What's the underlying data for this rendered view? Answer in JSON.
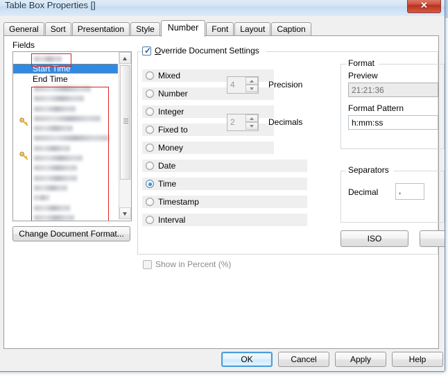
{
  "window": {
    "title": "Table Box Properties []",
    "close_icon": "close-icon",
    "close_glyph": "✕"
  },
  "tabs": [
    {
      "label": "General",
      "active": false
    },
    {
      "label": "Sort",
      "active": false
    },
    {
      "label": "Presentation",
      "active": false
    },
    {
      "label": "Style",
      "active": false
    },
    {
      "label": "Number",
      "active": true
    },
    {
      "label": "Font",
      "active": false
    },
    {
      "label": "Layout",
      "active": false
    },
    {
      "label": "Caption",
      "active": false
    }
  ],
  "fields": {
    "label": "Fields",
    "items": [
      {
        "text": "",
        "redacted": true,
        "selected": false,
        "key": false
      },
      {
        "text": "Start Time",
        "redacted": false,
        "selected": true,
        "key": false
      },
      {
        "text": "End Time",
        "redacted": false,
        "selected": false,
        "key": false
      },
      {
        "text": "",
        "redacted": true,
        "selected": false,
        "key": false
      },
      {
        "text": "",
        "redacted": true,
        "selected": false,
        "key": false
      },
      {
        "text": "",
        "redacted": true,
        "selected": false,
        "key": true
      },
      {
        "text": "",
        "redacted": true,
        "selected": false,
        "key": false
      },
      {
        "text": "",
        "redacted": true,
        "selected": false,
        "key": false
      },
      {
        "text": "",
        "redacted": true,
        "selected": false,
        "key": true
      },
      {
        "text": "",
        "redacted": true,
        "selected": false,
        "key": false
      },
      {
        "text": "",
        "redacted": true,
        "selected": false,
        "key": false
      },
      {
        "text": "",
        "redacted": true,
        "selected": false,
        "key": false
      },
      {
        "text": "",
        "redacted": true,
        "selected": false,
        "key": false
      },
      {
        "text": "",
        "redacted": true,
        "selected": false,
        "key": false
      },
      {
        "text": "",
        "redacted": true,
        "selected": false,
        "key": false
      },
      {
        "text": "",
        "redacted": true,
        "selected": false,
        "key": false
      },
      {
        "text": "",
        "redacted": true,
        "selected": false,
        "key": false
      }
    ],
    "scrollbar": {
      "up_icon": "scroll-up-arrow-icon",
      "down_icon": "scroll-down-arrow-icon"
    }
  },
  "change_document_format_button": "Change Document Format...",
  "override": {
    "label_prefix": "O",
    "label_rest": "verride Document Settings",
    "checked": true
  },
  "formats": [
    {
      "label": "Mixed",
      "selected": false
    },
    {
      "label": "Number",
      "selected": false
    },
    {
      "label": "Integer",
      "selected": false
    },
    {
      "label": "Fixed to",
      "selected": false
    },
    {
      "label": "Money",
      "selected": false
    },
    {
      "label": "Date",
      "selected": false
    },
    {
      "label": "Time",
      "selected": true
    },
    {
      "label": "Timestamp",
      "selected": false
    },
    {
      "label": "Interval",
      "selected": false
    }
  ],
  "precision": {
    "value": "4",
    "label": "Precision",
    "disabled": true
  },
  "decimals": {
    "value": "2",
    "label": "Decimals",
    "disabled": true
  },
  "show_in_percent": {
    "label": "Show in Percent (%)",
    "checked": false,
    "disabled": true
  },
  "format_group": {
    "title": "Format",
    "preview_label": "Preview",
    "preview_value": "21:21:36",
    "pattern_label": "Format Pattern",
    "pattern_value": "h:mm:ss"
  },
  "separators_group": {
    "title": "Separators",
    "decimal_label": "Decimal",
    "decimal_value": ","
  },
  "iso_button": "ISO",
  "footer": {
    "ok": "OK",
    "cancel": "Cancel",
    "apply": "Apply",
    "help": "Help"
  },
  "colors": {
    "selection_blue": "#2f8ae4",
    "default_button_border": "#4b9cd8",
    "radio_row_bg": "#efefef",
    "close_button_red": "#bb2f1c"
  }
}
